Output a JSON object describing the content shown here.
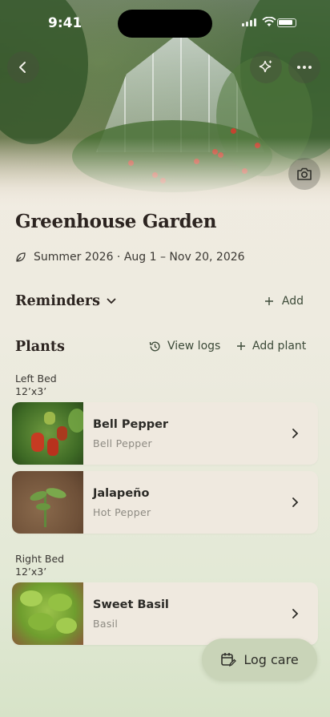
{
  "status_bar": {
    "time": "9:41"
  },
  "header": {
    "back_icon": "chevron-left-icon",
    "sparkle_icon": "sparkle-icon",
    "more_icon": "more-horizontal-icon",
    "camera_icon": "camera-icon"
  },
  "garden": {
    "title": "Greenhouse Garden",
    "season": "Summer 2026 · Aug 1 – Nov 20, 2026",
    "season_icon": "leaf-icon"
  },
  "reminders": {
    "title": "Reminders",
    "add_label": "Add"
  },
  "plants": {
    "title": "Plants",
    "view_logs_label": "View logs",
    "add_plant_label": "Add plant",
    "beds": [
      {
        "name": "Left Bed",
        "size": "12’x3’",
        "items": [
          {
            "name": "Bell Pepper",
            "type": "Bell Pepper"
          },
          {
            "name": "Jalapeño",
            "type": "Hot Pepper"
          }
        ]
      },
      {
        "name": "Right Bed",
        "size": "12’x3’",
        "items": [
          {
            "name": "Sweet Basil",
            "type": "Basil"
          }
        ]
      }
    ]
  },
  "fab": {
    "label": "Log care",
    "icon": "calendar-edit-icon"
  },
  "colors": {
    "accent_green": "#3c4a38",
    "fab_bg": "#c9d4b8",
    "card_bg": "#efe9df"
  }
}
